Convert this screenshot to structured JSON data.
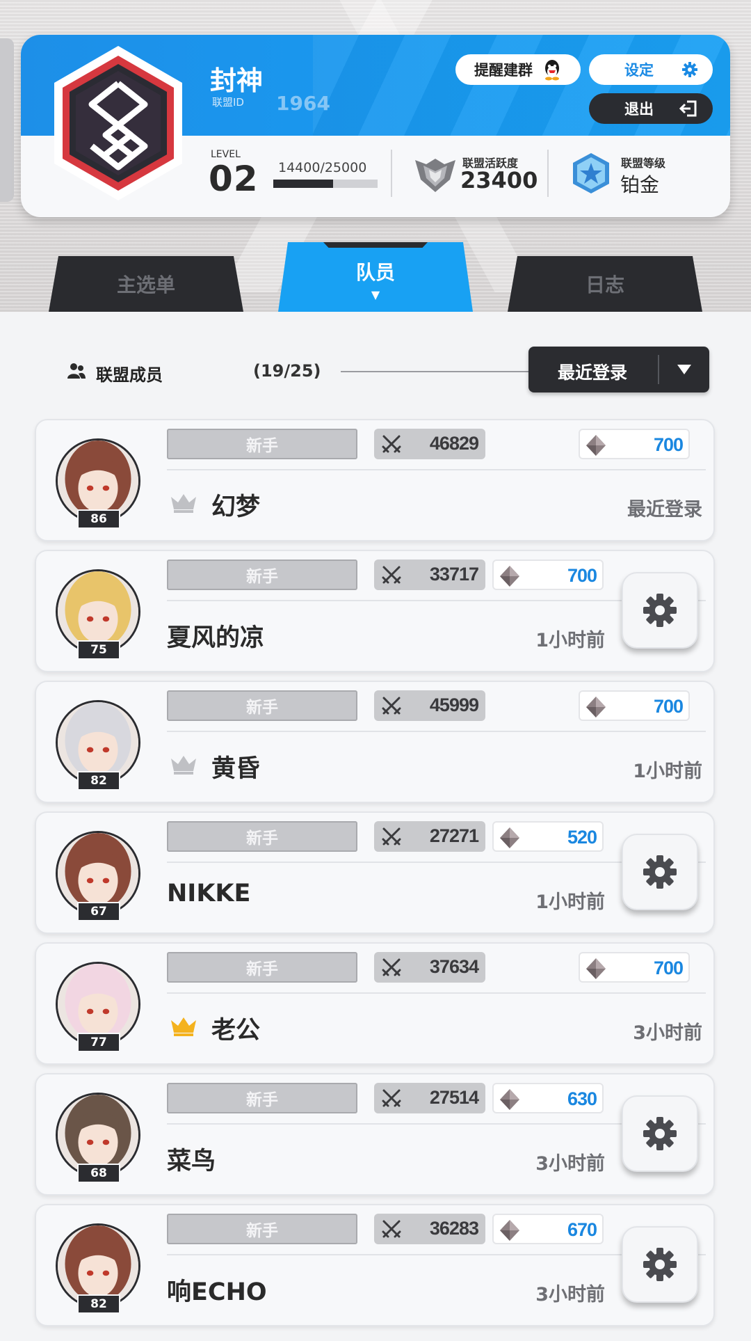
{
  "header": {
    "guild_name": "封神",
    "guild_id_label": "联盟ID",
    "guild_id": "1964",
    "remind_label": "提醒建群",
    "settings_label": "设定",
    "exit_label": "退出",
    "level_label": "LEVEL",
    "level": "02",
    "exp_text": "14400/25000",
    "exp_fraction": 0.576,
    "activity_label": "联盟活跃度",
    "activity_value": "23400",
    "rank_label": "联盟等级",
    "rank_value": "铂金"
  },
  "tabs": [
    {
      "label": "主选单",
      "active": false
    },
    {
      "label": "队员",
      "active": true
    },
    {
      "label": "日志",
      "active": false
    }
  ],
  "members_header": {
    "label": "联盟成员",
    "count": "(19/25)",
    "sort_label": "最近登录"
  },
  "members": [
    {
      "rank_tag": "新手",
      "power": "46829",
      "gems": "700",
      "name": "幻梦",
      "crown": "silver",
      "level": "86",
      "last_login": "最近登录",
      "gear": false,
      "hair": "#8a4a3a"
    },
    {
      "rank_tag": "新手",
      "power": "33717",
      "gems": "700",
      "name": "夏风的凉",
      "crown": null,
      "level": "75",
      "last_login": "1小时前",
      "gear": true,
      "hair": "#e8c46a"
    },
    {
      "rank_tag": "新手",
      "power": "45999",
      "gems": "700",
      "name": "黄昏",
      "crown": "silver",
      "level": "82",
      "last_login": "1小时前",
      "gear": false,
      "hair": "#d8d8de"
    },
    {
      "rank_tag": "新手",
      "power": "27271",
      "gems": "520",
      "name": "NIKKE",
      "crown": null,
      "level": "67",
      "last_login": "1小时前",
      "gear": true,
      "hair": "#8a4a3a"
    },
    {
      "rank_tag": "新手",
      "power": "37634",
      "gems": "700",
      "name": "老公",
      "crown": "gold",
      "level": "77",
      "last_login": "3小时前",
      "gear": false,
      "hair": "#f2d6e2"
    },
    {
      "rank_tag": "新手",
      "power": "27514",
      "gems": "630",
      "name": "菜鸟",
      "crown": null,
      "level": "68",
      "last_login": "3小时前",
      "gear": true,
      "hair": "#6a5548"
    },
    {
      "rank_tag": "新手",
      "power": "36283",
      "gems": "670",
      "name": "响ECHO",
      "crown": null,
      "level": "82",
      "last_login": "3小时前",
      "gear": true,
      "hair": "#8a4a3a"
    }
  ],
  "colors": {
    "accent_blue": "#18a1f3",
    "dark": "#2b2c30",
    "gem_blue": "#1a87e0",
    "crown_gold": "#f4b21e",
    "crown_silver": "#bfc0c4"
  },
  "icons": {
    "qq": "qq-penguin-icon",
    "settings": "gear-icon",
    "exit": "exit-icon",
    "activity": "shield-wings-icon",
    "rank": "platinum-star-icon",
    "members": "users-icon",
    "sort": "chevron-down-icon",
    "power": "crossed-swords-icon",
    "gems": "diamond-icon",
    "crown": "crown-icon"
  }
}
